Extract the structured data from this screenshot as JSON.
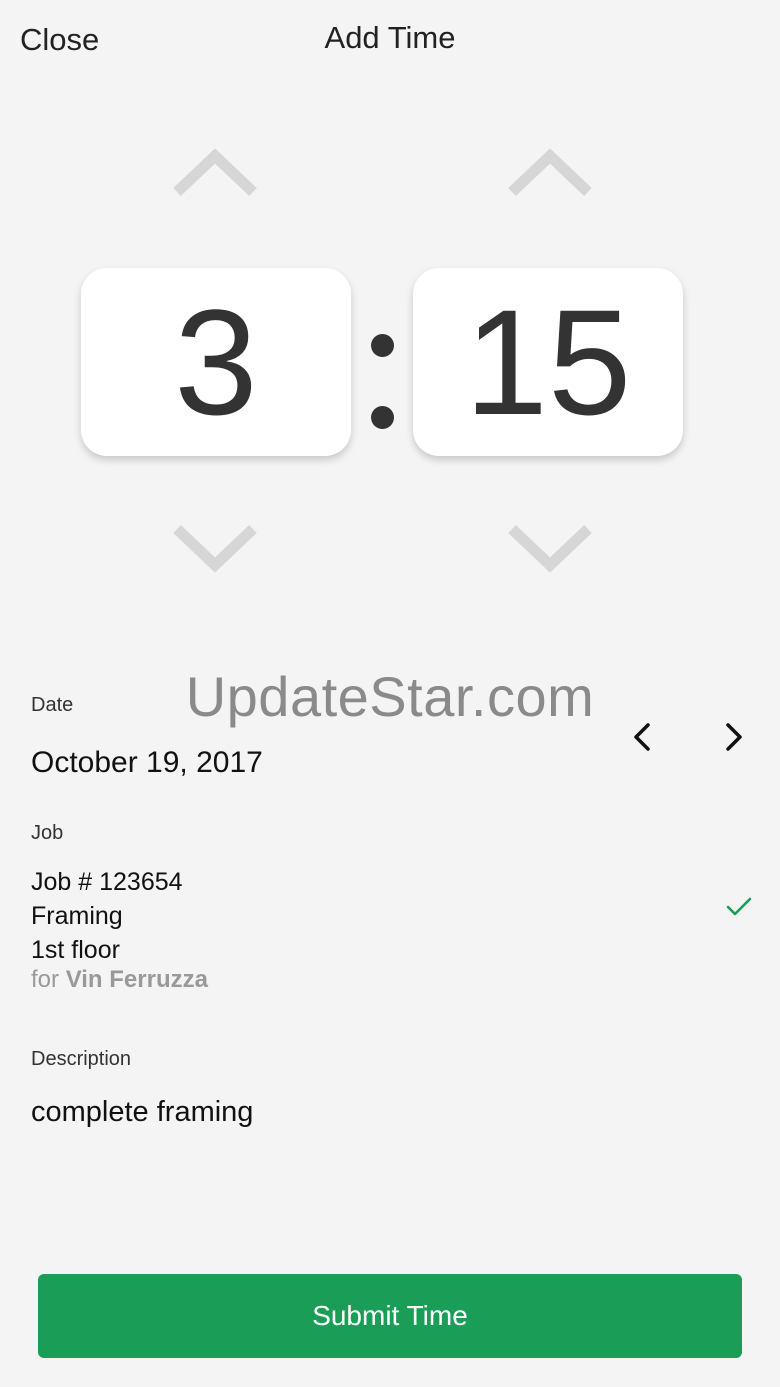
{
  "header": {
    "close_label": "Close",
    "title": "Add Time"
  },
  "time": {
    "hours": "3",
    "separator": ":",
    "minutes": "15"
  },
  "watermark": "UpdateStar.com",
  "date": {
    "label": "Date",
    "value": "October 19, 2017"
  },
  "job": {
    "label": "Job",
    "number": "Job # 123654",
    "task": "Framing",
    "location": "1st floor",
    "client_prefix": "for",
    "client_name": "Vin Ferruzza",
    "selected": true
  },
  "description": {
    "label": "Description",
    "value": "complete framing"
  },
  "submit_label": "Submit Time",
  "colors": {
    "background": "#f4f4f4",
    "accent": "#1a9e57",
    "chevron": "#d6d6d6",
    "check": "#1a9e57"
  },
  "icons": {
    "hour_up": "chevron-up-icon",
    "hour_down": "chevron-down-icon",
    "minute_up": "chevron-up-icon",
    "minute_down": "chevron-down-icon",
    "prev_date": "chevron-left-icon",
    "next_date": "chevron-right-icon",
    "job_selected": "checkmark-icon"
  }
}
